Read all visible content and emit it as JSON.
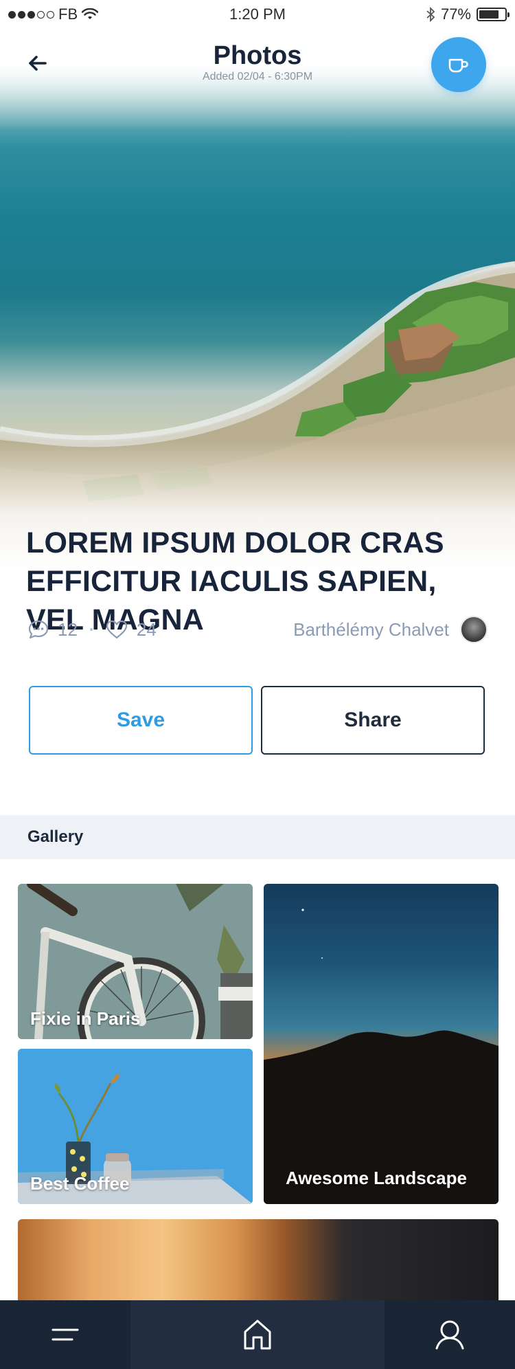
{
  "status_bar": {
    "carrier": "FB",
    "time": "1:20 PM",
    "battery": "77%",
    "signal_bars_filled": 3,
    "signal_bars_total": 5
  },
  "header": {
    "title": "Photos",
    "subtitle": "Added 02/04 - 6:30PM",
    "back_icon": "arrow-left-icon",
    "action_icon": "coffee-cup-icon"
  },
  "article": {
    "title": "LOREM IPSUM DOLOR CRAS EFFICITUR IACULIS SAPIEN, VEL MAGNA",
    "comments": "12",
    "likes": "24",
    "author": "Barthélémy Chalvet"
  },
  "actions": {
    "save_label": "Save",
    "share_label": "Share"
  },
  "gallery": {
    "section_title": "Gallery",
    "items": [
      {
        "label": "Fixie in Paris"
      },
      {
        "label": "Best Coffee"
      },
      {
        "label": "Awesome Landscape"
      }
    ]
  },
  "bottom_nav": {
    "items": [
      "menu-icon",
      "home-icon",
      "user-icon"
    ]
  },
  "colors": {
    "accent": "#3ea6ec",
    "save_border": "#2d9ce3",
    "dark": "#17243a",
    "nav_bg": "#1a2535",
    "meta_text": "#8a9bb3"
  }
}
